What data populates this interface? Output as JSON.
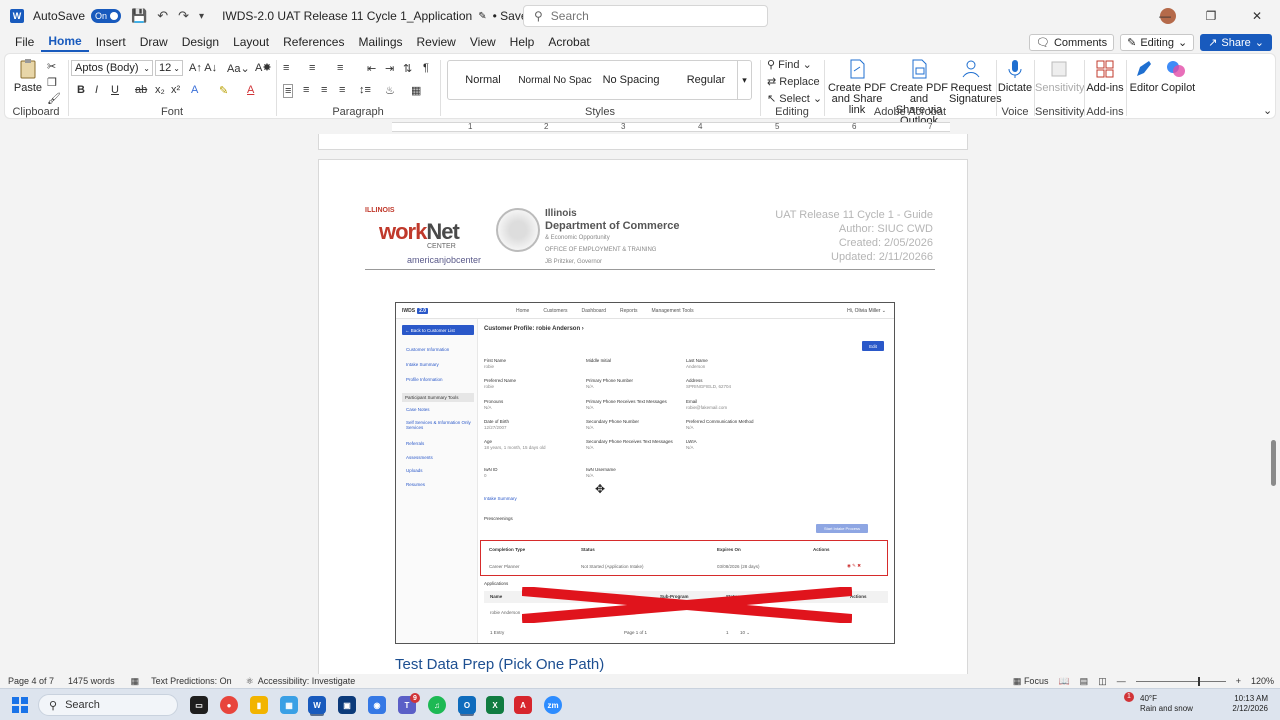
{
  "titlebar": {
    "autosave_label": "AutoSave",
    "autosave_state": "On",
    "doc_title": "IWDS-2.0 UAT Release 11 Cycle 1_Application",
    "save_status": "Saved",
    "search_placeholder": "Search"
  },
  "menu": {
    "items": [
      "File",
      "Home",
      "Insert",
      "Draw",
      "Design",
      "Layout",
      "References",
      "Mailings",
      "Review",
      "View",
      "Help",
      "Acrobat"
    ],
    "active": "Home",
    "comments": "Comments",
    "editing": "Editing",
    "share": "Share"
  },
  "ribbon": {
    "paste": "Paste",
    "font_name": "Aptos (Body)",
    "font_size": "12",
    "groups": {
      "clipboard": "Clipboard",
      "font": "Font",
      "paragraph": "Paragraph",
      "styles": "Styles",
      "editing": "Editing",
      "adobe": "Adobe Acrobat",
      "voice": "Voice",
      "sensitivity": "Sensitivity",
      "addins": "Add-ins"
    },
    "styles": [
      "Normal",
      "Normal No Spac",
      "No Spacing",
      "Regular"
    ],
    "find": "Find",
    "replace": "Replace",
    "select": "Select",
    "create_pdf_link_1": "Create PDF",
    "create_pdf_link_2": "and Share link",
    "create_pdf_outlook_1": "Create PDF and",
    "create_pdf_outlook_2": "Share via Outlook",
    "request_sig_1": "Request",
    "request_sig_2": "Signatures",
    "dictate": "Dictate",
    "sensitivity": "Sensitivity",
    "addins": "Add-ins",
    "editor": "Editor",
    "copilot": "Copilot"
  },
  "ruler_numbers": [
    "1",
    "1",
    "2",
    "3",
    "4",
    "5",
    "6",
    "7"
  ],
  "doc_header": {
    "illinois": "ILLINOIS",
    "worknet_a": "work",
    "worknet_b": "Net",
    "center": "CENTER",
    "ajc": "americanjobcenter",
    "dept_1": "Illinois",
    "dept_2": "Department of Commerce",
    "dept_3": "& Economic Opportunity",
    "dept_4": "OFFICE OF EMPLOYMENT & TRAINING",
    "dept_5": "JB Pritzker, Governor",
    "meta": [
      "UAT Release 11 Cycle 1 - Guide",
      "Author: SIUC CWD",
      "Created: 2/05/2026",
      "Updated: 2/11/20266"
    ]
  },
  "shot": {
    "brand": "IWDS",
    "brand_tag": "2.0",
    "nav": [
      "Home",
      "Customers",
      "Dashboard",
      "Reports",
      "Management Tools"
    ],
    "user": "Hi, Olivia Miller",
    "back": "Back to Customer List",
    "side_links": [
      "Customer Information",
      "Intake Summary",
      "Profile Information"
    ],
    "side_head": "Participant Summary Tools",
    "side_links2": [
      "Case Notes",
      "Self Services & Information Only Services",
      "Referrals",
      "Assessments",
      "Uploads",
      "Resumes"
    ],
    "title": "Customer Profile: robie Anderson",
    "edit": "Edit",
    "fields": [
      {
        "k": "First Name",
        "v": "robie"
      },
      {
        "k": "Middle Initial",
        "v": ""
      },
      {
        "k": "Last Name",
        "v": "Anderson"
      },
      {
        "k": "Preferred Name",
        "v": "robie"
      },
      {
        "k": "Primary Phone Number",
        "v": "N/A"
      },
      {
        "k": "Address",
        "v": "SPRINGFIELD, 62704"
      },
      {
        "k": "Pronouns",
        "v": "N/A"
      },
      {
        "k": "Primary Phone Receives Text Messages",
        "v": "N/A"
      },
      {
        "k": "Email",
        "v": "robie@fakemail.com"
      },
      {
        "k": "Date of Birth",
        "v": "12/27/2007"
      },
      {
        "k": "Secondary Phone Number",
        "v": "N/A"
      },
      {
        "k": "Preferred Communication Method",
        "v": "N/A"
      },
      {
        "k": "Age",
        "v": "18 years, 1 month, 15 days old"
      },
      {
        "k": "Secondary Phone Receives Text Messages",
        "v": "N/A"
      },
      {
        "k": "LWIA",
        "v": "N/A"
      },
      {
        "k": "IwN ID",
        "v": "0"
      },
      {
        "k": "IwN Username",
        "v": "N/A"
      }
    ],
    "intake_summary": "Intake Summary",
    "prescreenings": "Prescreenings",
    "start_btn": "Start Intake Process",
    "prescreen_cols": [
      "Completion Type",
      "Status",
      "Expires On",
      "Actions"
    ],
    "prescreen_row": [
      "Career Planner",
      "Not Started (Application Intake)",
      "03/08/2026 (28 days)"
    ],
    "applications": "Applications",
    "app_cols": [
      "Name",
      "Program",
      "Sub-Program",
      "Status",
      "Actions"
    ],
    "app_row": "robie Anderson",
    "entries": "1 Entry",
    "page_of": "Page 1 of 1",
    "page_num": "1",
    "per_page": "10"
  },
  "doc_heading": "Test Data Prep (Pick One Path)",
  "status": {
    "page": "Page 4 of 7",
    "words": "1475 words",
    "predictions": "Text Predictions: On",
    "accessibility": "Accessibility: Investigate",
    "focus": "Focus",
    "zoom": "120%"
  },
  "taskbar": {
    "search": "Search",
    "teams_badge": "9",
    "weather_badge": "1",
    "temp": "40°F",
    "weather": "Rain and snow",
    "time": "10:13 AM",
    "date": "2/12/2026"
  }
}
